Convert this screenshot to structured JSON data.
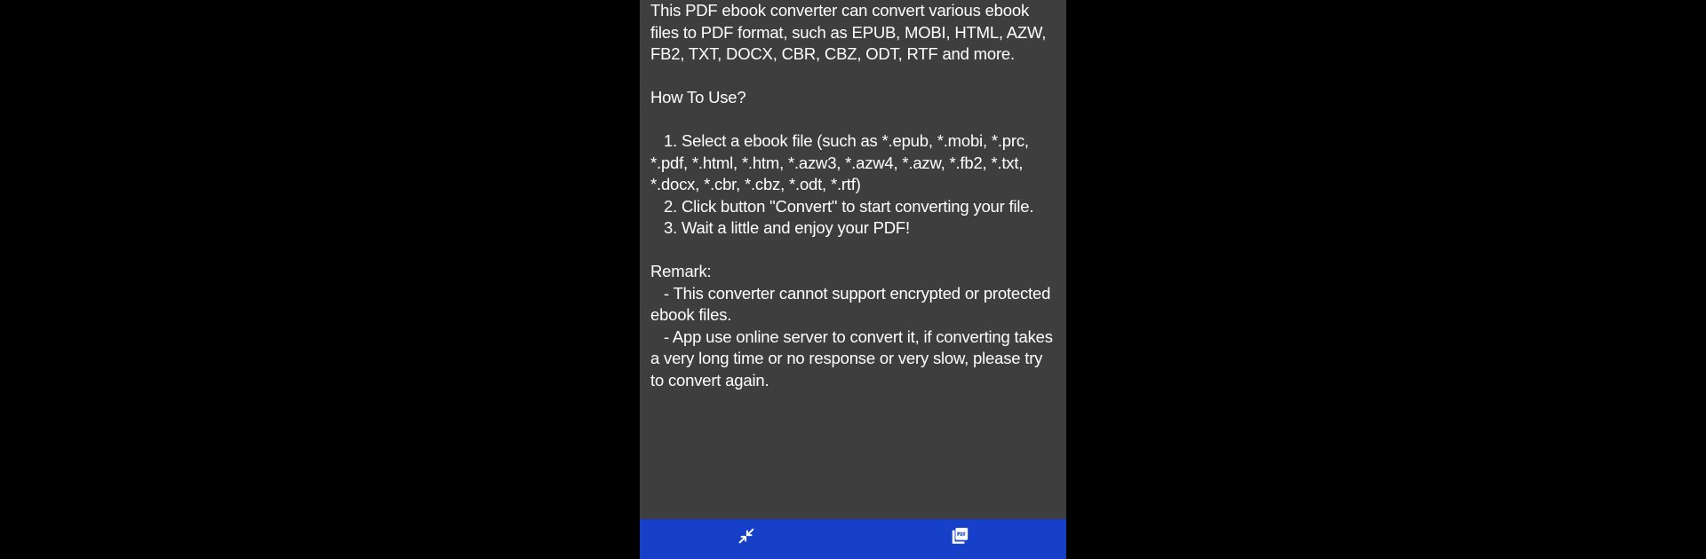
{
  "colors": {
    "outer_background": "#000000",
    "app_background": "#3e3e3e",
    "nav_background": "#1640c8",
    "text": "#ffffff"
  },
  "description": {
    "intro": "This PDF ebook converter can convert various ebook files to PDF format, such as EPUB, MOBI, HTML, AZW, FB2, TXT, DOCX, CBR, CBZ, ODT, RTF and more.",
    "how_to_title": "How To Use?",
    "steps": [
      "1. Select a ebook file (such as *.epub, *.mobi, *.prc, *.pdf, *.html, *.htm, *.azw3, *.azw4, *.azw, *.fb2, *.txt, *.docx, *.cbr, *.cbz, *.odt, *.rtf)",
      "2. Click button \"Convert\" to start converting your file.",
      "3. Wait a little and enjoy your PDF!"
    ],
    "remark_title": "Remark:",
    "remarks": [
      "- This converter cannot support encrypted or protected ebook files.",
      "- App use online server to convert it, if converting takes a very long time or no response or very slow, please try to convert again."
    ]
  },
  "bottom_nav": {
    "items": [
      {
        "icon": "compress-arrows-icon",
        "label": ""
      },
      {
        "icon": "pdf-file-icon",
        "label": ""
      }
    ]
  }
}
